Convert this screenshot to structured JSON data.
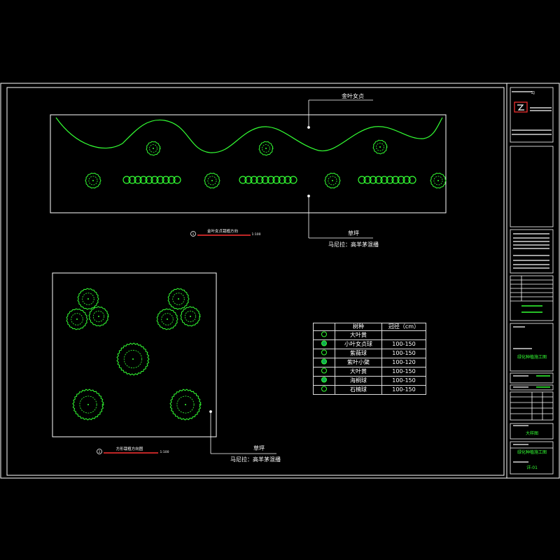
{
  "upper_plan": {
    "caption": "金叶女贞栽植方向",
    "scale": "1:100",
    "marker": "1",
    "label_top": "金叶女贞",
    "label_right_1": "草坪",
    "label_right_2": "马尼拉：高羊茅混播"
  },
  "lower_plan": {
    "caption": "方形栽植方向图",
    "scale": "1:100",
    "marker": "2",
    "label_right_1": "草坪",
    "label_right_2": "马尼拉：高羊茅混播"
  },
  "legend": {
    "headers": [
      "",
      "树种",
      "冠径（cm）"
    ],
    "rows": [
      {
        "name": "大叶黄",
        "size": ""
      },
      {
        "name": "小叶女贞球",
        "size": "100-150"
      },
      {
        "name": "紫薇球",
        "size": "100-150"
      },
      {
        "name": "紫叶小檗",
        "size": "100-120"
      },
      {
        "name": "大叶黄",
        "size": "100-150"
      },
      {
        "name": "海桐球",
        "size": "100-150"
      },
      {
        "name": "石楠球",
        "size": "100-150"
      }
    ]
  },
  "title_block": {
    "company_mark": "ZJ",
    "project": "绿化种植施工图",
    "drawing": "大样图",
    "sheet": "详-01"
  },
  "colors": {
    "line_white": "#ffffff",
    "plant_green": "#33ff33",
    "accent_red": "#ff3333"
  }
}
